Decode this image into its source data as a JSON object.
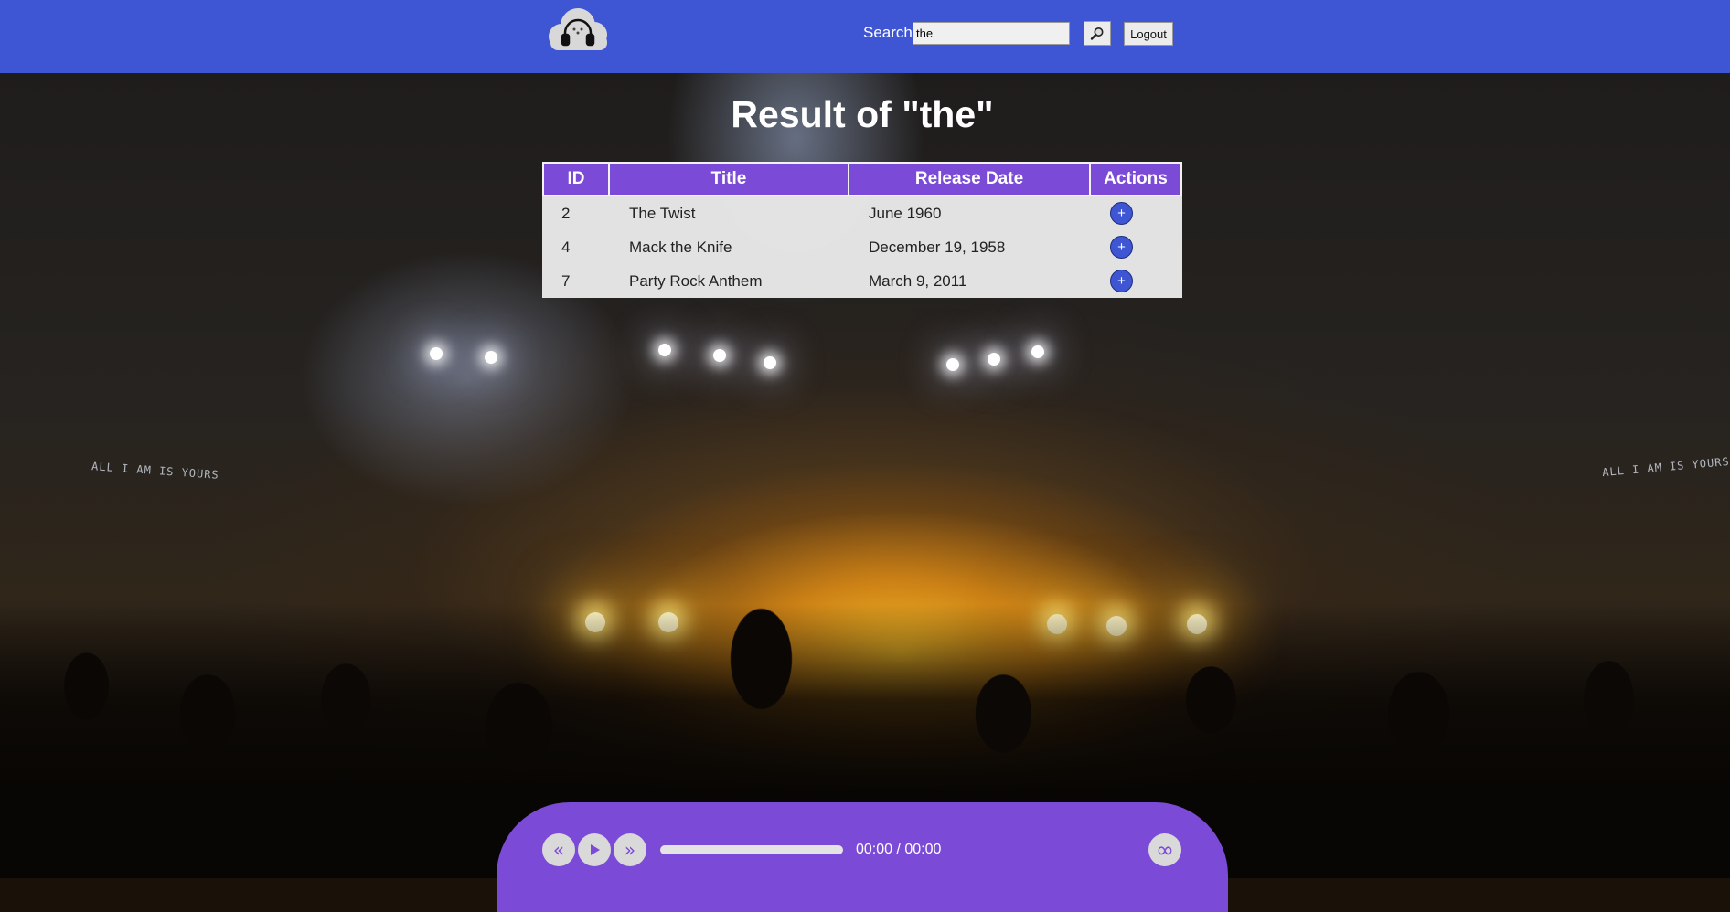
{
  "header": {
    "logo_alt": "music cloud logo",
    "search_label": "Search",
    "search_value": "the",
    "logout_label": "Logout",
    "accent_color": "#3f56d4"
  },
  "screen_captions": [
    "ALL I AM IS YOURS",
    "ALL I AM IS YOURS"
  ],
  "main": {
    "title": "Result of \"the\"",
    "table": {
      "columns": [
        "ID",
        "Title",
        "Release Date",
        "Actions"
      ],
      "rows": [
        {
          "id": "2",
          "title": "The Twist",
          "release_date": "June 1960",
          "action": "+"
        },
        {
          "id": "4",
          "title": "Mack the Knife",
          "release_date": "December 19, 1958",
          "action": "+"
        },
        {
          "id": "7",
          "title": "Party Rock Anthem",
          "release_date": "March 9, 2011",
          "action": "+"
        }
      ],
      "header_color": "#7b4ad6"
    }
  },
  "player": {
    "time": "00:00 / 00:00",
    "progress": 0,
    "prev_icon": "«",
    "play_icon": "play-icon",
    "next_icon": "»",
    "loop_icon": "∞",
    "color": "#7b4ad6"
  }
}
